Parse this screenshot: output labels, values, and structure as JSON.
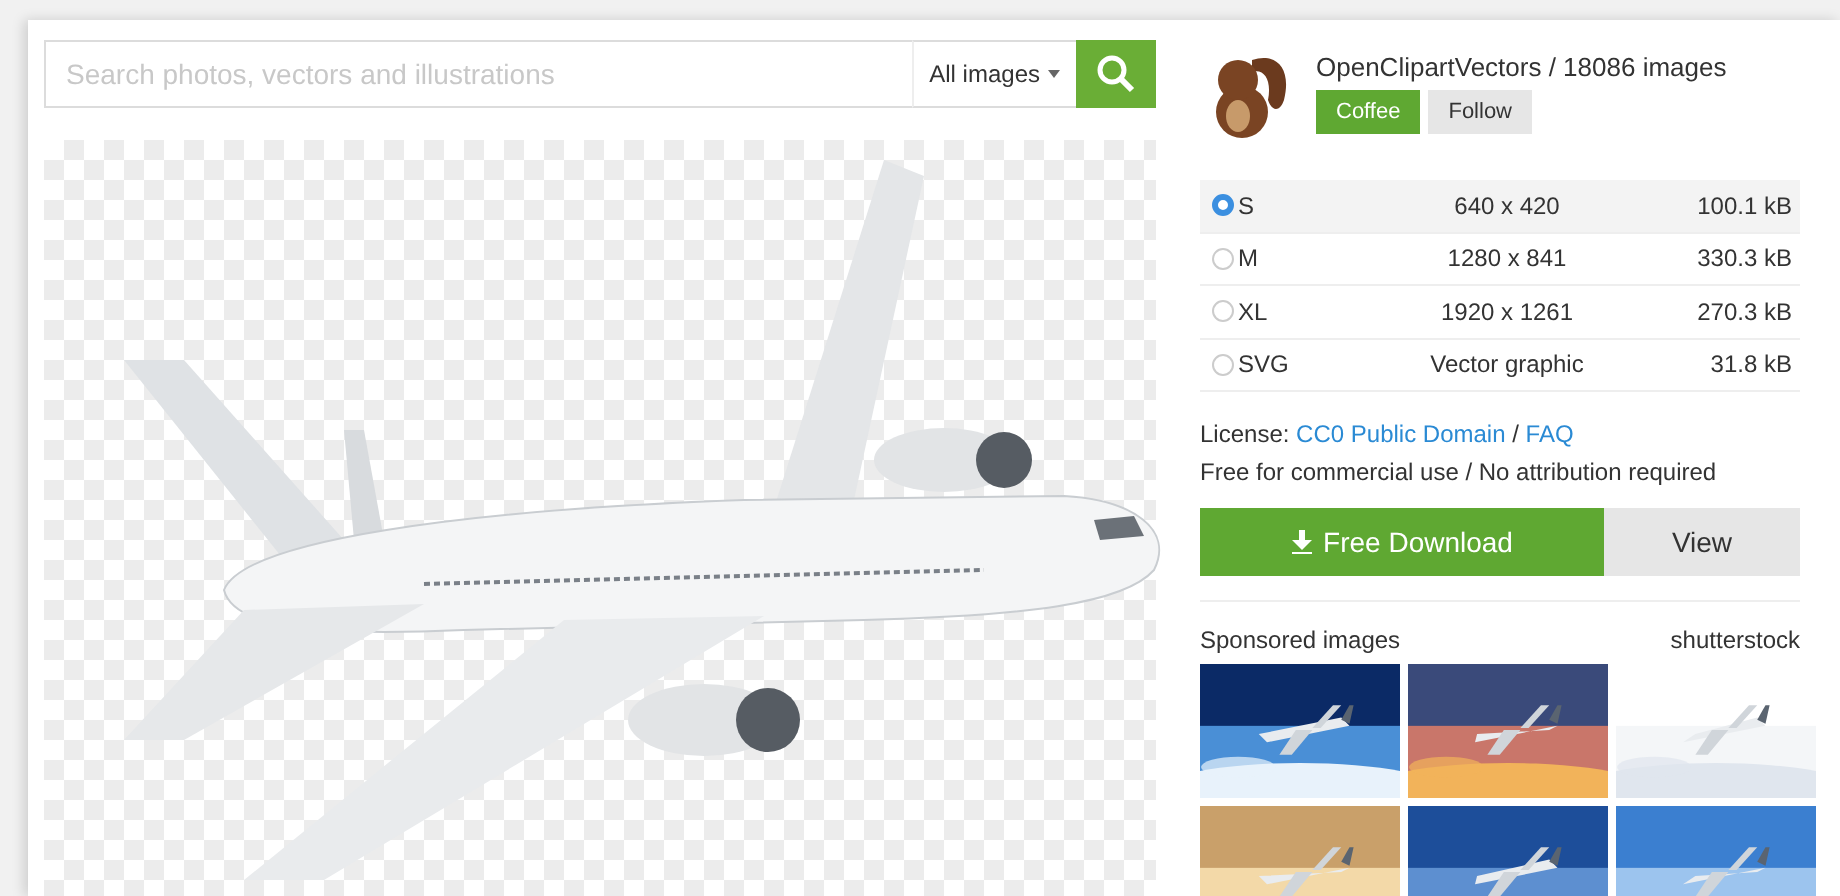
{
  "search": {
    "placeholder": "Search photos, vectors and illustrations",
    "category": "All images"
  },
  "author": {
    "name": "OpenClipartVectors / 18086 images",
    "coffee": "Coffee",
    "follow": "Follow"
  },
  "sizes": [
    {
      "label": "S",
      "dimensions": "640 x 420",
      "filesize": "100.1 kB",
      "selected": true
    },
    {
      "label": "M",
      "dimensions": "1280 x 841",
      "filesize": "330.3 kB",
      "selected": false
    },
    {
      "label": "XL",
      "dimensions": "1920 x 1261",
      "filesize": "270.3 kB",
      "selected": false
    },
    {
      "label": "SVG",
      "dimensions": "Vector graphic",
      "filesize": "31.8 kB",
      "selected": false
    }
  ],
  "license": {
    "prefix": "License:",
    "link": "CC0 Public Domain",
    "separator": "/",
    "faq": "FAQ",
    "note": "Free for commercial use / No attribution required"
  },
  "actions": {
    "download": "Free Download",
    "view": "View"
  },
  "sponsored": {
    "title": "Sponsored images",
    "brand": "shutterstock"
  }
}
